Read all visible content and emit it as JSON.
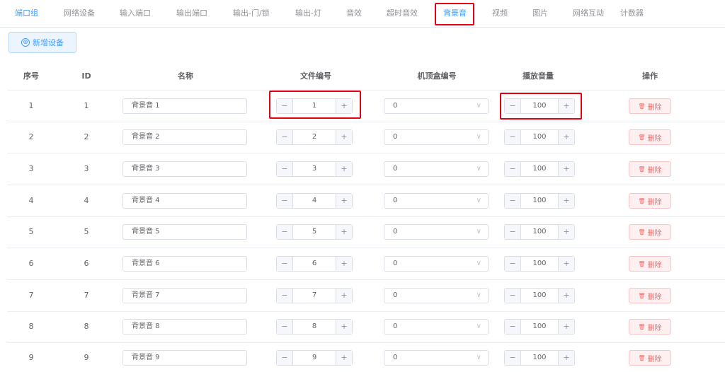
{
  "tabs": [
    "端口组",
    "网络设备",
    "输入端口",
    "输出端口",
    "输出-门/锁",
    "输出-灯",
    "音效",
    "超时音效",
    "背景音",
    "视频",
    "图片",
    "网络互动",
    "计数器"
  ],
  "active_tab": "背景音",
  "add_button": "新增设备",
  "add_icon": "⊕",
  "headers": {
    "index": "序号",
    "id": "ID",
    "name": "名称",
    "file_no": "文件编号",
    "stb_no": "机顶盒编号",
    "volume": "播放音量",
    "action": "操作"
  },
  "stepper": {
    "minus": "−",
    "plus": "+"
  },
  "delete_label": "删除",
  "delete_icon": "🗑",
  "rows": [
    {
      "index": "1",
      "id": "1",
      "name": "背景音 1",
      "file_no": "1",
      "stb_no": "0",
      "volume": "100"
    },
    {
      "index": "2",
      "id": "2",
      "name": "背景音 2",
      "file_no": "2",
      "stb_no": "0",
      "volume": "100"
    },
    {
      "index": "3",
      "id": "3",
      "name": "背景音 3",
      "file_no": "3",
      "stb_no": "0",
      "volume": "100"
    },
    {
      "index": "4",
      "id": "4",
      "name": "背景音 4",
      "file_no": "4",
      "stb_no": "0",
      "volume": "100"
    },
    {
      "index": "5",
      "id": "5",
      "name": "背景音 5",
      "file_no": "5",
      "stb_no": "0",
      "volume": "100"
    },
    {
      "index": "6",
      "id": "6",
      "name": "背景音 6",
      "file_no": "6",
      "stb_no": "0",
      "volume": "100"
    },
    {
      "index": "7",
      "id": "7",
      "name": "背景音 7",
      "file_no": "7",
      "stb_no": "0",
      "volume": "100"
    },
    {
      "index": "8",
      "id": "8",
      "name": "背景音 8",
      "file_no": "8",
      "stb_no": "0",
      "volume": "100"
    },
    {
      "index": "9",
      "id": "9",
      "name": "背景音 9",
      "file_no": "9",
      "stb_no": "0",
      "volume": "100"
    }
  ],
  "colors": {
    "accent": "#409eff",
    "highlight": "#e60012",
    "danger": "#f56c6c"
  }
}
